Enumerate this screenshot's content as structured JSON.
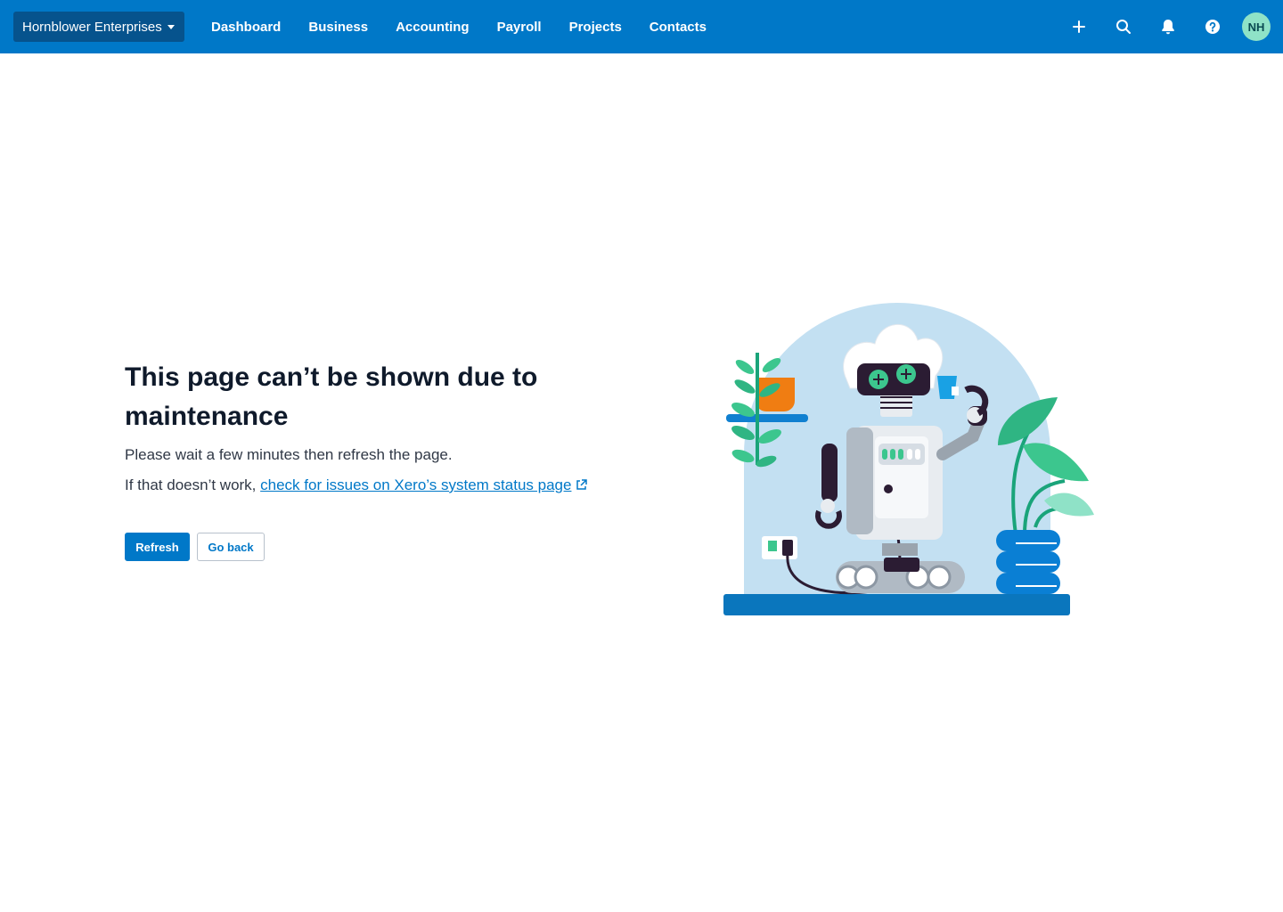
{
  "header": {
    "org_name": "Hornblower Enterprises",
    "nav": [
      "Dashboard",
      "Business",
      "Accounting",
      "Payroll",
      "Projects",
      "Contacts"
    ],
    "icons": [
      "plus-icon",
      "search-icon",
      "bell-icon",
      "help-icon"
    ],
    "avatar_initials": "NH"
  },
  "main": {
    "title": "This page can’t be shown due to maintenance",
    "line1": "Please wait a few minutes then refresh the page.",
    "line2_prefix": "If that doesn’t work,",
    "status_link": "check for issues on Xero’s system status page",
    "refresh_label": "Refresh",
    "go_back_label": "Go back"
  },
  "colors": {
    "brand_blue": "#0078c8",
    "org_switcher_bg": "#06538d",
    "avatar_bg": "#8fe2c7",
    "illustration_bg": "#c3e0f2"
  }
}
